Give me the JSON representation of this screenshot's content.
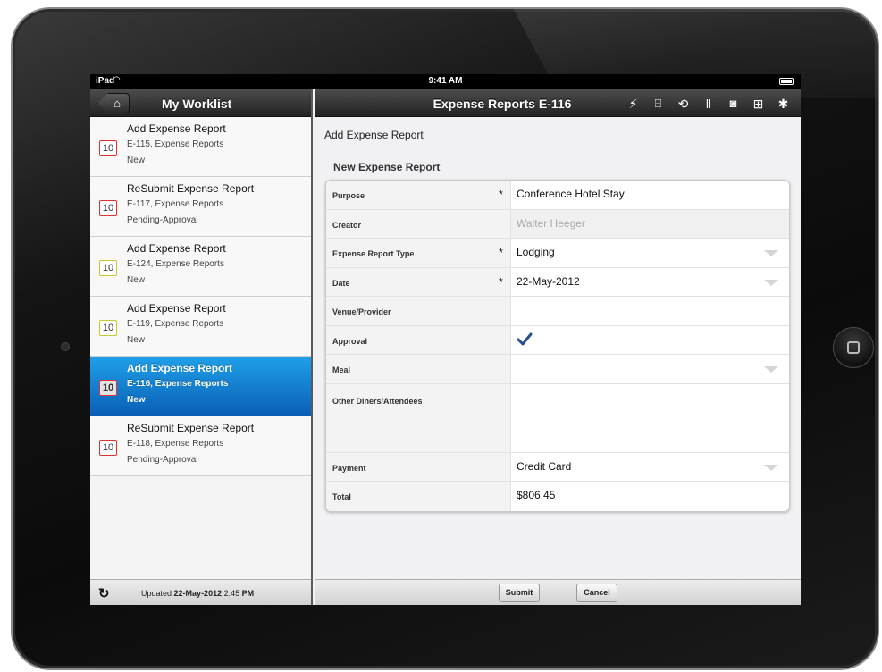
{
  "status_bar": {
    "carrier": "iPad",
    "time": "9:41 AM"
  },
  "left_pane": {
    "title": "My Worklist",
    "items": [
      {
        "badge": "10",
        "title": "Add Expense Report",
        "subtitle": "E-115, Expense Reports",
        "status": "New",
        "badge_color": "red"
      },
      {
        "badge": "10",
        "title": "ReSubmit Expense Report",
        "subtitle": "E-117, Expense Reports",
        "status": "Pending-Approval",
        "badge_color": "red"
      },
      {
        "badge": "10",
        "title": "Add Expense Report",
        "subtitle": "E-124, Expense Reports",
        "status": "New",
        "badge_color": "yellow"
      },
      {
        "badge": "10",
        "title": "Add Expense Report",
        "subtitle": "E-119, Expense Reports",
        "status": "New",
        "badge_color": "yellow"
      },
      {
        "badge": "10",
        "title": "Add Expense Report",
        "subtitle": "E-116, Expense Reports",
        "status": "New",
        "badge_color": "red",
        "selected": true
      },
      {
        "badge": "10",
        "title": "ReSubmit Expense Report",
        "subtitle": "E-118, Expense Reports",
        "status": "Pending-Approval",
        "badge_color": "red"
      }
    ],
    "footer": {
      "updated_prefix": "Updated",
      "updated_date": "22-May-2012",
      "updated_time": "2:45",
      "updated_ampm": "PM"
    }
  },
  "right_pane": {
    "title": "Expense Reports E-116",
    "toolbar_icons": [
      "flash-icon",
      "document-icon",
      "history-icon",
      "paperclip-icon",
      "camera-icon",
      "add-page-icon",
      "gear-icon"
    ],
    "breadcrumb": "Add Expense Report",
    "section_title": "New Expense Report",
    "fields": {
      "purpose": {
        "label": "Purpose",
        "value": "Conference Hotel Stay",
        "required": "*"
      },
      "creator": {
        "label": "Creator",
        "value": "Walter Heeger"
      },
      "type": {
        "label": "Expense Report Type",
        "value": "Lodging",
        "required": "*"
      },
      "date": {
        "label": "Date",
        "value": "22-May-2012",
        "required": "*"
      },
      "venue": {
        "label": "Venue/Provider",
        "value": ""
      },
      "approval": {
        "label": "Approval",
        "checked": true
      },
      "meal": {
        "label": "Meal",
        "value": ""
      },
      "attendees": {
        "label": "Other Diners/Attendees",
        "value": ""
      },
      "payment": {
        "label": "Payment",
        "value": "Credit Card"
      },
      "total": {
        "label": "Total",
        "value": "$806.45"
      }
    },
    "buttons": {
      "submit": "Submit",
      "cancel": "Cancel"
    }
  },
  "colors": {
    "selection_top": "#1fa0e8",
    "selection_bottom": "#0a5fb7",
    "check": "#2a4d8f",
    "badge_red": "#dd3333",
    "badge_yellow": "#c8c832"
  }
}
